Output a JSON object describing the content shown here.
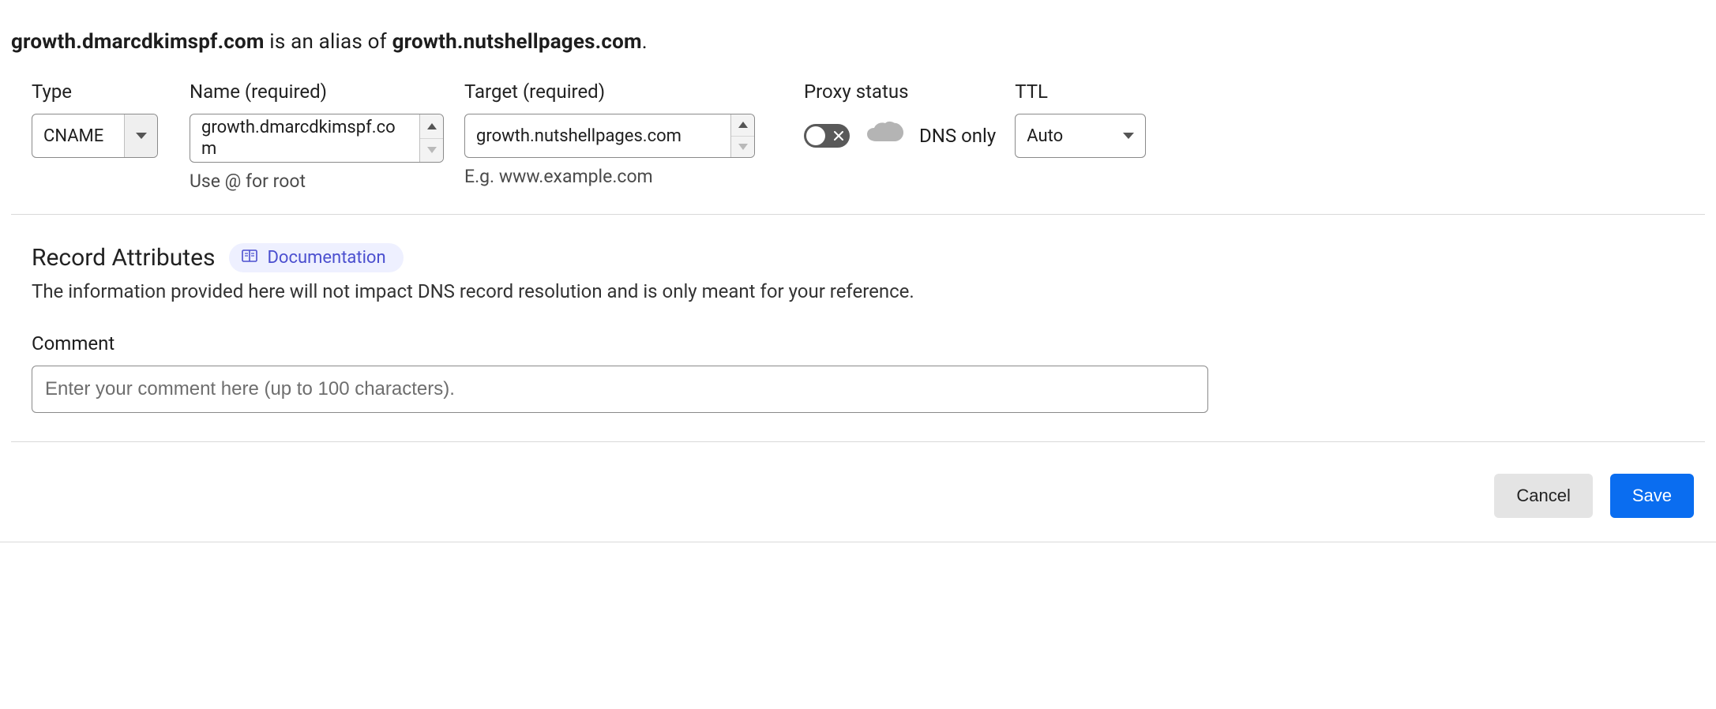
{
  "summary": {
    "source": "growth.dmarcdkimspf.com",
    "middle_text": " is an alias of ",
    "target": "growth.nutshellpages.com",
    "trailing": "."
  },
  "fields": {
    "type": {
      "label": "Type",
      "value": "CNAME"
    },
    "name": {
      "label": "Name (required)",
      "value": "growth.dmarcdkimspf.com",
      "helper": "Use @ for root"
    },
    "target": {
      "label": "Target (required)",
      "value": "growth.nutshellpages.com",
      "helper": "E.g. www.example.com"
    },
    "proxy": {
      "label": "Proxy status",
      "status_text": "DNS only",
      "toggle_state": "off"
    },
    "ttl": {
      "label": "TTL",
      "value": "Auto"
    }
  },
  "record_attributes": {
    "title": "Record Attributes",
    "doc_link": "Documentation",
    "description": "The information provided here will not impact DNS record resolution and is only meant for your reference."
  },
  "comment": {
    "label": "Comment",
    "placeholder": "Enter your comment here (up to 100 characters)."
  },
  "buttons": {
    "cancel": "Cancel",
    "save": "Save"
  }
}
